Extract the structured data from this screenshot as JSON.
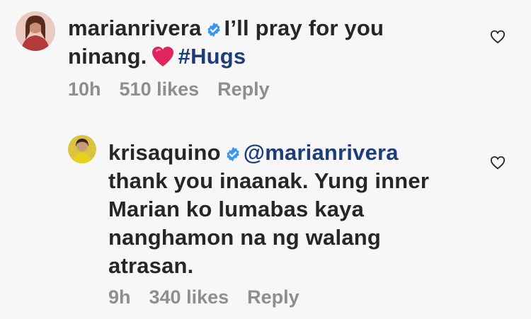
{
  "comments": [
    {
      "username": "marianrivera",
      "text_line1": "I’ll pray for you",
      "text_line2": "ninang.",
      "hashtag": "#Hugs",
      "time": "10h",
      "likes": "510 likes",
      "reply": "Reply"
    },
    {
      "username": "krisaquino",
      "mention": "@marianrivera",
      "text_lines": [
        "thank you inaanak. Yung inner",
        "Marian ko lumabas kaya",
        "nanghamon na ng walang",
        "atrasan."
      ],
      "time": "9h",
      "likes": "340 likes",
      "reply": "Reply"
    }
  ],
  "colors": {
    "text": "#262626",
    "meta": "#8e8e8e",
    "link": "#1d3c7b",
    "verified": "#3897f0",
    "heart_emoji": "#e0245e"
  },
  "icons": {
    "verified": "verified-badge-icon",
    "heart_emoji": "red-heart-emoji",
    "like": "heart-outline-icon"
  }
}
